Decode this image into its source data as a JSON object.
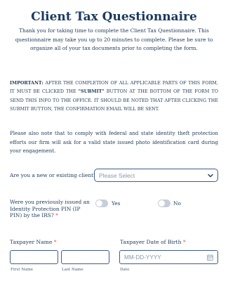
{
  "form": {
    "title": "Client Tax Questionnaire",
    "subtitle": "Thank you for taking time to complete the Client Tax Questionnaire. This questionnaire may take you up to 20 minutes to complete. Please be sure to organize all of your tax documents prior to completing the form.",
    "important_label": "IMPORTANT:",
    "important_text_1": " AFTER THE COMPLETION OF ALL APPLICABLE PARTS OF THIS FORM, IT MUST BE CLICKED THE ",
    "important_submit": "\"SUBMIT\"",
    "important_text_2": " BUTTON AT THE BOTTOM OF THE FORM TO SEND THIS INFO TO THE OFFICE. IT SHOULD BE NOTED THAT AFTER CLICKING THE SUBMIT BUTTON, THE CONFIRMATION EMAIL WILL BE SENT.",
    "notice": "Please also note that to comply with federal and state identity theft protection efforts our firm will ask for a valid state issued photo identification card during your engagement."
  },
  "client_type": {
    "label": "Are you a new or existing client?",
    "required_mark": "*",
    "placeholder": "Please Select"
  },
  "ip_pin": {
    "label": "Were you previously issued an Identity Protection PIN (IP PIN) by the IRS?",
    "required_mark": "*",
    "yes_label": "Yes",
    "no_label": "No"
  },
  "taxpayer_name": {
    "label": "Taxpayer Name",
    "required_mark": "*",
    "first_sublabel": "First Name",
    "last_sublabel": "Last Name"
  },
  "taxpayer_dob": {
    "label": "Taxpayer Date of Birth",
    "required_mark": "*",
    "placeholder": "MM-DD-YYYY",
    "sublabel": "Date"
  }
}
